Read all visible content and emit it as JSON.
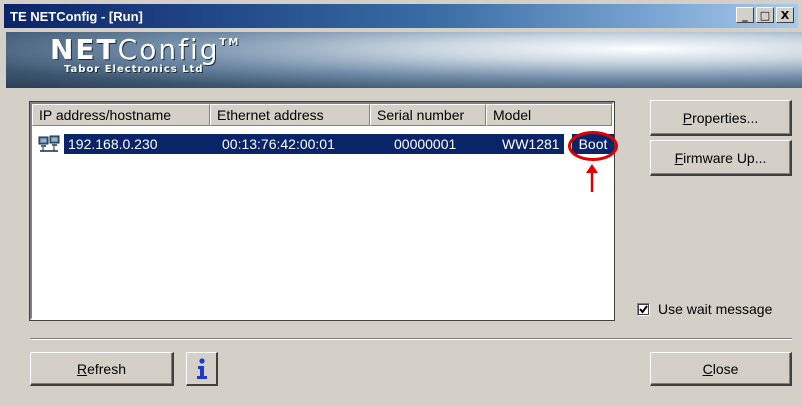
{
  "window": {
    "title": "TE NETConfig - [Run]"
  },
  "caption": {
    "minimize": "_",
    "maximize": "□",
    "close": "X"
  },
  "banner": {
    "logo_bold": "NET",
    "logo_light": "Config",
    "logo_tm": "TM",
    "logo_sub": "Tabor Electronics Ltd"
  },
  "list": {
    "columns": [
      "IP address/hostname",
      "Ethernet address",
      "Serial number",
      "Model"
    ],
    "rows": [
      {
        "ip": "192.168.0.230",
        "mac": "00:13:76:42:00:01",
        "serial": "00000001",
        "model": "WW1281",
        "status": "Boot"
      }
    ]
  },
  "buttons": {
    "properties": {
      "ul": "P",
      "rest": "roperties..."
    },
    "firmware": {
      "ul": "F",
      "rest": "irmware Up..."
    },
    "refresh": {
      "ul": "R",
      "rest": "efresh"
    },
    "close": {
      "ul": "C",
      "rest": "lose"
    }
  },
  "options": {
    "use_wait_message": {
      "label": "Use wait message",
      "checked": true
    }
  },
  "colors": {
    "selection": "#0a246a",
    "annotation": "#e10000"
  },
  "icons": {
    "row": "network-computer-icon",
    "info": "info-icon",
    "annotation": "up-arrow-icon"
  }
}
